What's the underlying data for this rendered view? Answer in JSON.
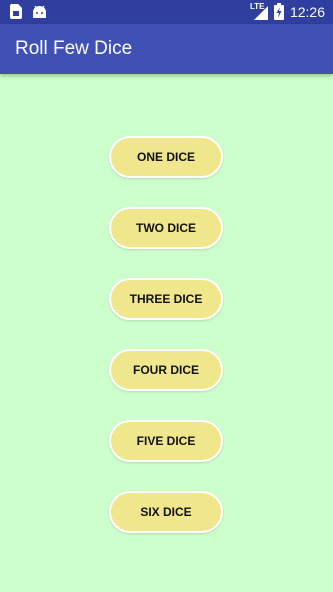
{
  "status_bar": {
    "network": "LTE",
    "time": "12:26",
    "icons": [
      "sim-card-icon",
      "android-icon",
      "signal-icon",
      "battery-charging-icon"
    ]
  },
  "app_bar": {
    "title": "Roll Few Dice"
  },
  "buttons": [
    {
      "label": "ONE DICE"
    },
    {
      "label": "TWO DICE"
    },
    {
      "label": "THREE DICE"
    },
    {
      "label": "FOUR DICE"
    },
    {
      "label": "FIVE DICE"
    },
    {
      "label": "SIX DICE"
    }
  ],
  "colors": {
    "status_bar": "#303f9f",
    "app_bar": "#3f51b5",
    "background": "#ccffcc",
    "button": "#f0e68c"
  }
}
